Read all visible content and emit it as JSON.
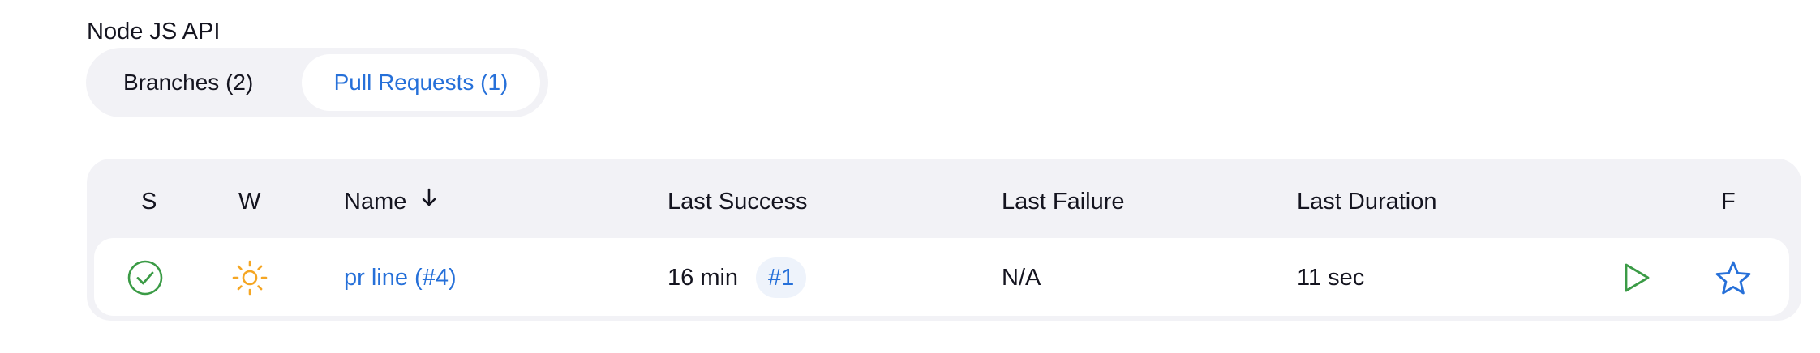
{
  "project": {
    "title": "Node JS API"
  },
  "tabs": [
    {
      "label": "Branches (2)",
      "active": false
    },
    {
      "label": "Pull Requests (1)",
      "active": true
    }
  ],
  "table": {
    "columns": {
      "status": "S",
      "weather": "W",
      "name": "Name",
      "last_success": "Last Success",
      "last_failure": "Last Failure",
      "last_duration": "Last Duration",
      "favorite": "F"
    },
    "sort": {
      "column": "Name",
      "direction": "descending",
      "icon": "arrow-down-icon"
    },
    "rows": [
      {
        "status_icon": "check-circle-icon",
        "weather_icon": "sun-icon",
        "name": "pr line (#4)",
        "last_success": "16 min",
        "last_success_build": "#1",
        "last_failure": "N/A",
        "last_duration": "11 sec",
        "action_icon": "play-icon",
        "favorite_icon": "star-icon"
      }
    ]
  },
  "colors": {
    "accent": "#2670d9",
    "success": "#3b9b46",
    "weather": "#f5a623",
    "panel_bg": "#f2f2f6",
    "text": "#14141f"
  }
}
